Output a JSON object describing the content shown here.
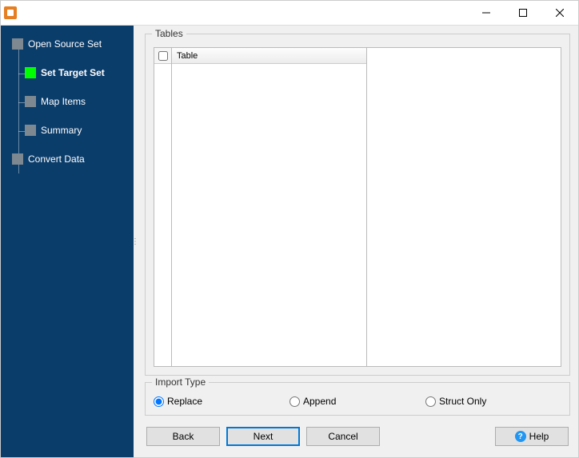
{
  "title_bar": {
    "title": ""
  },
  "sidebar": {
    "items": [
      {
        "label": "Open Source Set",
        "active": false,
        "level": 0
      },
      {
        "label": "Set Target Set",
        "active": true,
        "level": 1
      },
      {
        "label": "Map Items",
        "active": false,
        "level": 1
      },
      {
        "label": "Summary",
        "active": false,
        "level": 1
      },
      {
        "label": "Convert Data",
        "active": false,
        "level": 0
      }
    ]
  },
  "tables_group": {
    "title": "Tables",
    "column_header": "Table"
  },
  "import_type": {
    "title": "Import Type",
    "options": [
      {
        "label": "Replace",
        "checked": true
      },
      {
        "label": "Append",
        "checked": false
      },
      {
        "label": "Struct Only",
        "checked": false
      }
    ]
  },
  "buttons": {
    "back": "Back",
    "next": "Next",
    "cancel": "Cancel",
    "help": "Help"
  }
}
